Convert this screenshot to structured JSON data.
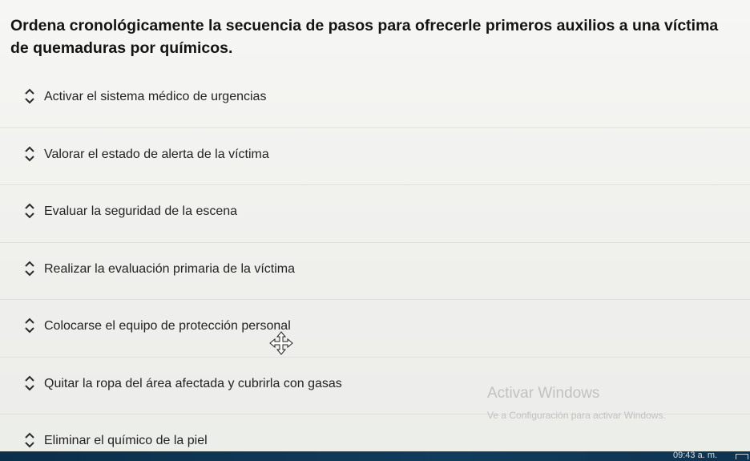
{
  "question": {
    "text": "Ordena cronológicamente la secuencia de pasos para ofrecerle primeros auxilios a una víctima de quemaduras por químicos."
  },
  "items": [
    {
      "label": "Activar el sistema médico de urgencias"
    },
    {
      "label": "Valorar el estado de alerta de la víctima"
    },
    {
      "label": "Evaluar la seguridad de la escena"
    },
    {
      "label": "Realizar la evaluación primaria de la víctima"
    },
    {
      "label": "Colocarse el equipo de protección personal"
    },
    {
      "label": "Quitar la ropa del área afectada y cubrirla con gasas"
    },
    {
      "label": "Eliminar el químico de la piel"
    }
  ],
  "watermark": {
    "title": "Activar Windows",
    "subtitle": "Ve a Configuración para activar Windows."
  },
  "taskbar": {
    "clock": "09:43 a. m."
  },
  "icons": {
    "handle": "sort-updown-icon",
    "cursor": "move-cursor-icon"
  }
}
